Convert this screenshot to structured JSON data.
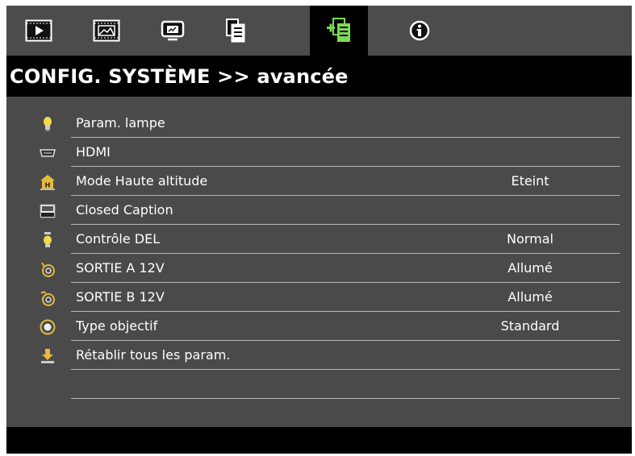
{
  "tabs": [
    {
      "icon": "image-settings-icon"
    },
    {
      "icon": "display-settings-icon"
    },
    {
      "icon": "setup-icon"
    },
    {
      "icon": "system-settings-icon"
    },
    {
      "icon": "advanced-system-settings-icon",
      "active": true
    },
    {
      "icon": "info-icon"
    }
  ],
  "colors": {
    "active_icon": "#7ed957",
    "inactive_icon": "#ffffff",
    "background": "#4a4a4a",
    "title_bar": "#000000",
    "separator": "#b8b8b8"
  },
  "header": {
    "title": "CONFIG. SYSTÈME >> avancée"
  },
  "menu": {
    "items": [
      {
        "icon": "lamp-icon",
        "label": "Param. lampe",
        "value": ""
      },
      {
        "icon": "hdmi-icon",
        "label": "HDMI",
        "value": ""
      },
      {
        "icon": "high-altitude-icon",
        "label": "Mode Haute altitude",
        "value": "Eteint"
      },
      {
        "icon": "closed-caption-icon",
        "label": "Closed Caption",
        "value": ""
      },
      {
        "icon": "led-icon",
        "label": "Contrôle DEL",
        "value": "Normal"
      },
      {
        "icon": "trigger-a-icon",
        "label": "SORTIE A 12V",
        "value": "Allumé"
      },
      {
        "icon": "trigger-b-icon",
        "label": "SORTIE B 12V",
        "value": "Allumé"
      },
      {
        "icon": "lens-type-icon",
        "label": "Type objectif",
        "value": "Standard"
      },
      {
        "icon": "reset-icon",
        "label": "Rétablir tous les param.",
        "value": ""
      }
    ]
  }
}
